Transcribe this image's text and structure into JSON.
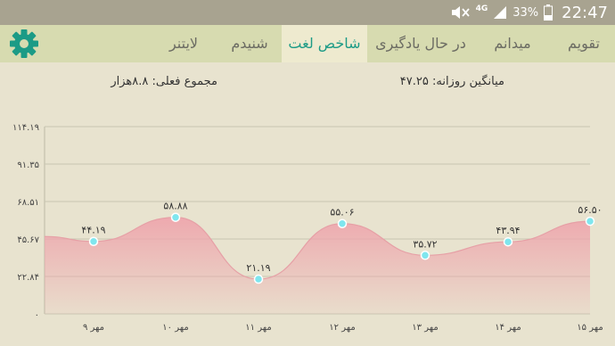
{
  "status_bar": {
    "network": "4G",
    "battery": "33%",
    "time": "22:47",
    "icons": [
      "mute-icon",
      "signal-icon",
      "battery-icon"
    ]
  },
  "tabs": [
    {
      "label": "تقویم",
      "active": false
    },
    {
      "label": "میدانم",
      "active": false
    },
    {
      "label": "در حال یادگیری",
      "active": false
    },
    {
      "label": "شاخص لغت",
      "active": true
    },
    {
      "label": "شنیدم",
      "active": false
    },
    {
      "label": "لایتنر",
      "active": false
    }
  ],
  "settings_icon": "gear-icon",
  "colors": {
    "accent": "#1c9b86",
    "area_fill": "#eea6ad",
    "point": "#7fe6ee"
  },
  "stats": {
    "daily_average": "میانگین روزانه: ۴۷.۲۵",
    "total_active": "مجموع فعلی: ۸.۸هزار"
  },
  "chart_data": {
    "type": "area",
    "y_ticks": [
      {
        "value": 0,
        "label": "۰"
      },
      {
        "value": 22.84,
        "label": "۲۲.۸۴"
      },
      {
        "value": 45.67,
        "label": "۴۵.۶۷"
      },
      {
        "value": 68.51,
        "label": "۶۸.۵۱"
      },
      {
        "value": 91.35,
        "label": "۹۱.۳۵"
      },
      {
        "value": 114.19,
        "label": "۱۱۴.۱۹"
      }
    ],
    "ylim": [
      0,
      114.19
    ],
    "categories": [
      "۹ مهر",
      "۱۰ مهر",
      "۱۱ مهر",
      "۱۲ مهر",
      "۱۳ مهر",
      "۱۴ مهر",
      "۱۵ مهر"
    ],
    "values": [
      44.19,
      58.88,
      21.19,
      55.06,
      35.72,
      43.94,
      56.5
    ],
    "value_labels": [
      "۴۴.۱۹",
      "۵۸.۸۸",
      "۲۱.۱۹",
      "۵۵.۰۶",
      "۳۵.۷۲",
      "۴۳.۹۴",
      "۵۶.۵۰"
    ],
    "grid": true
  }
}
